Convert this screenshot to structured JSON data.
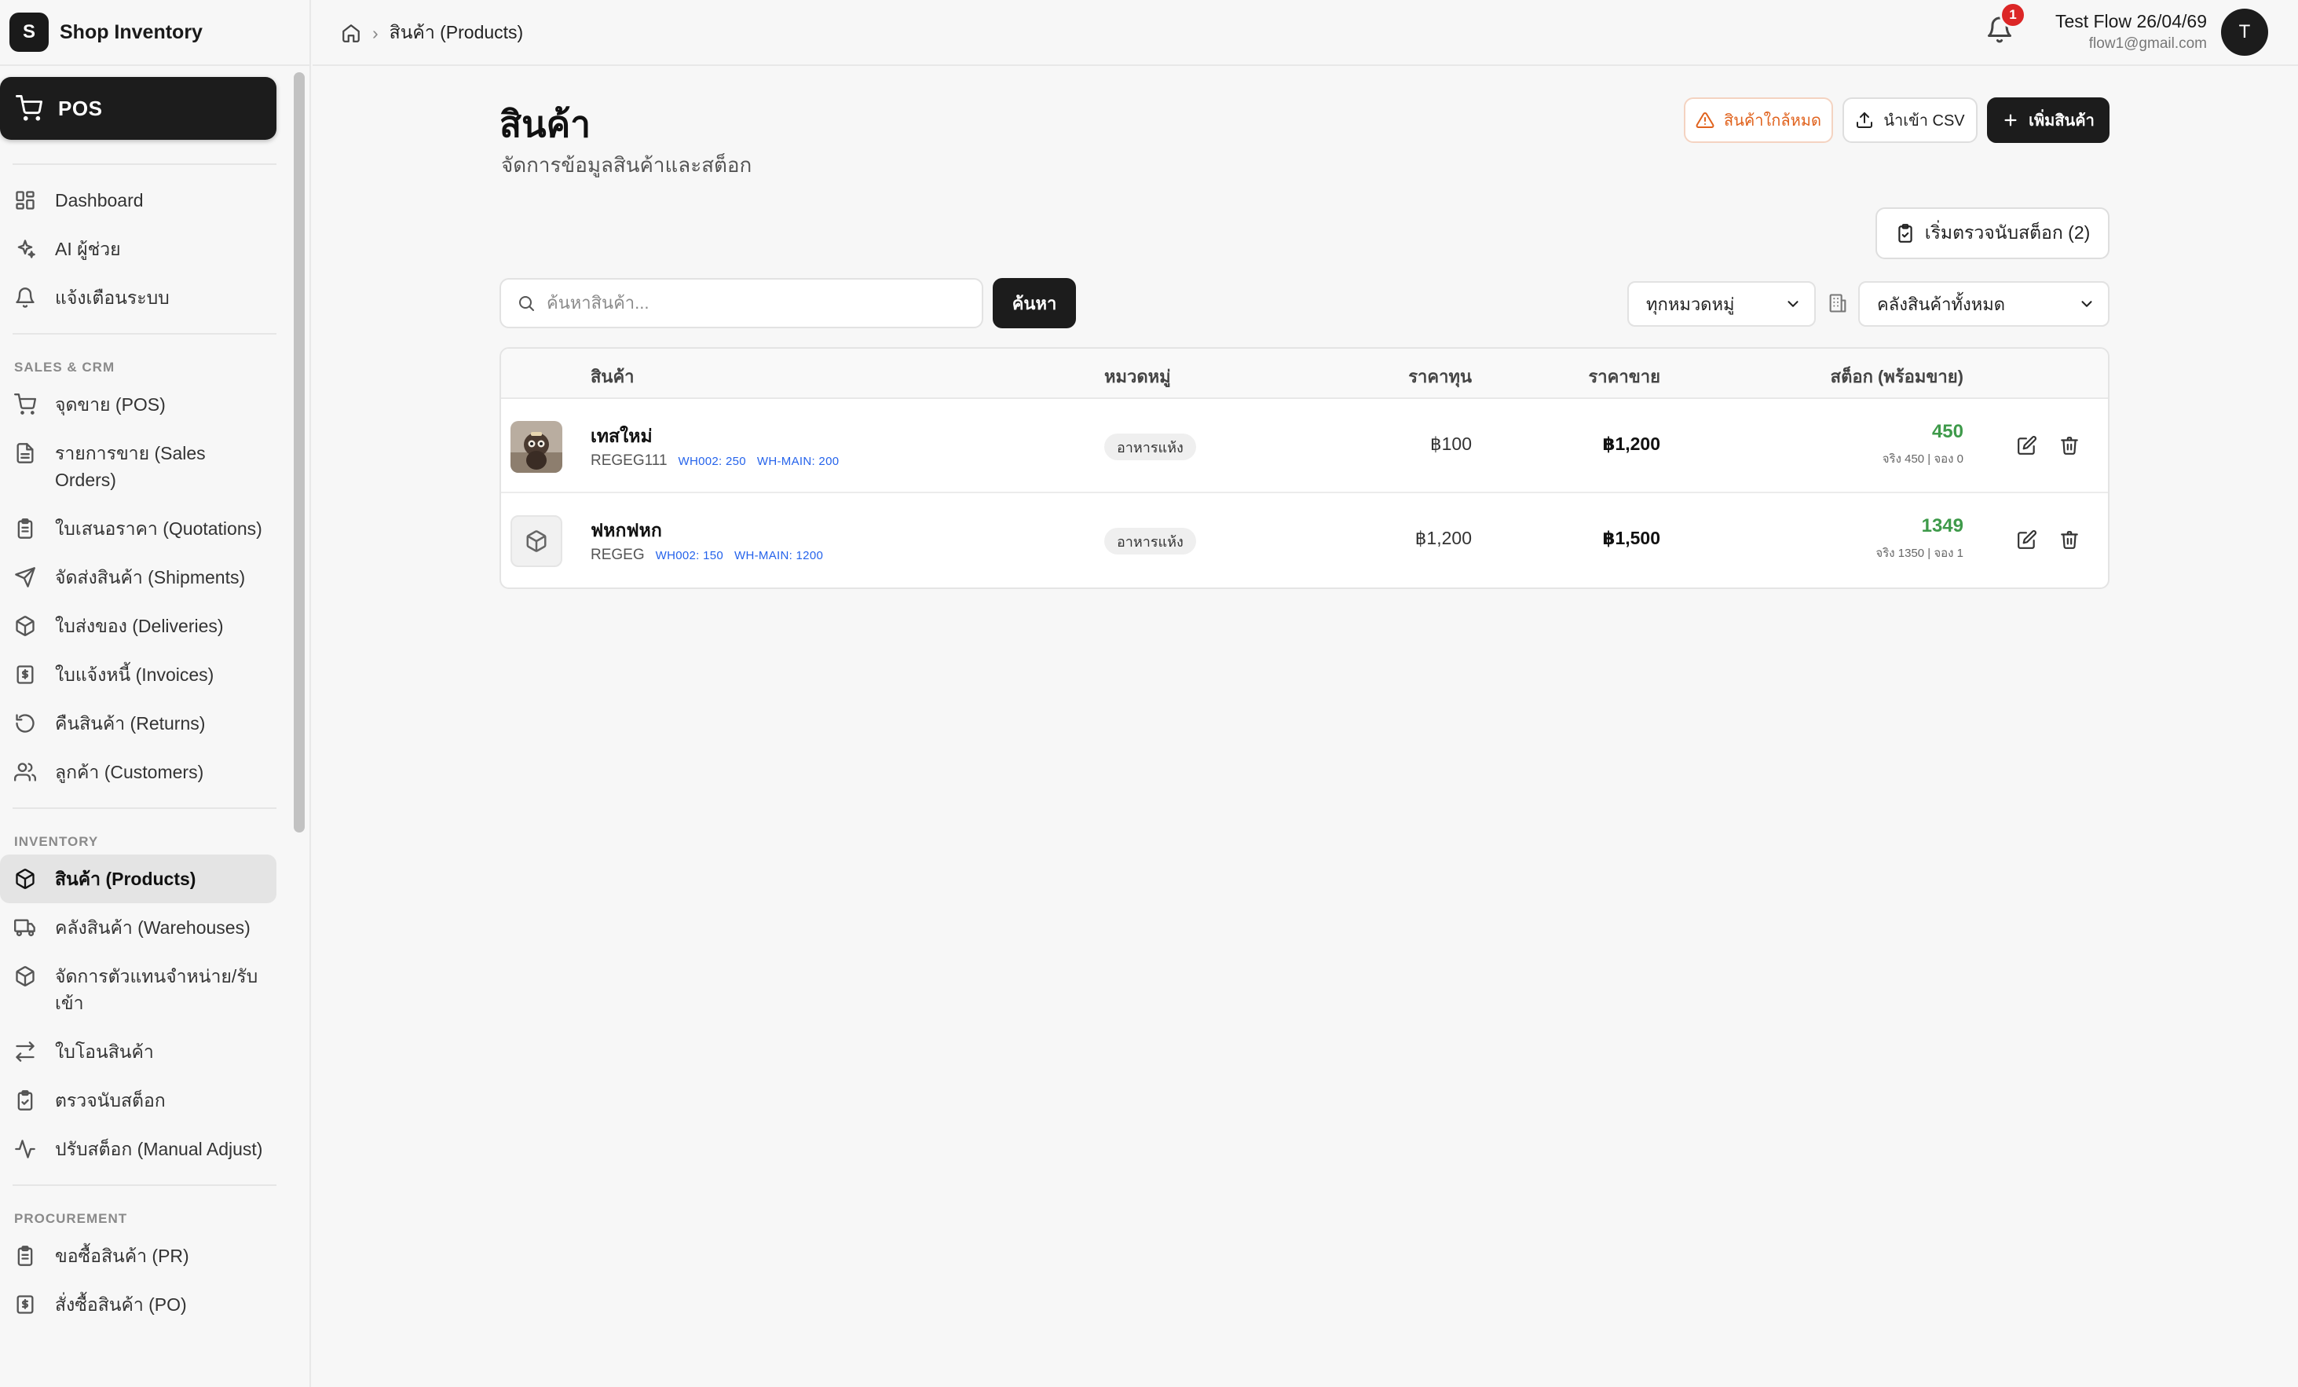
{
  "app": {
    "logo_letter": "S",
    "name": "Shop Inventory"
  },
  "pos_button": "POS",
  "nav": {
    "top_items": [
      {
        "label": "Dashboard",
        "icon": "grid-icon"
      },
      {
        "label": "AI ผู้ช่วย",
        "icon": "sparkle-icon"
      },
      {
        "label": "แจ้งเตือนระบบ",
        "icon": "bell-icon"
      }
    ],
    "sections": [
      {
        "title": "SALES & CRM",
        "items": [
          {
            "label": "จุดขาย (POS)",
            "icon": "cart-icon"
          },
          {
            "label": "รายการขาย (Sales Orders)",
            "icon": "document-icon"
          },
          {
            "label": "ใบเสนอราคา (Quotations)",
            "icon": "clipboard-list-icon"
          },
          {
            "label": "จัดส่งสินค้า (Shipments)",
            "icon": "send-icon"
          },
          {
            "label": "ใบส่งของ (Deliveries)",
            "icon": "package-icon"
          },
          {
            "label": "ใบแจ้งหนี้ (Invoices)",
            "icon": "invoice-icon"
          },
          {
            "label": "คืนสินค้า (Returns)",
            "icon": "rotate-icon"
          },
          {
            "label": "ลูกค้า (Customers)",
            "icon": "users-icon"
          }
        ]
      },
      {
        "title": "INVENTORY",
        "items": [
          {
            "label": "สินค้า (Products)",
            "icon": "package-icon",
            "active": true
          },
          {
            "label": "คลังสินค้า (Warehouses)",
            "icon": "truck-icon"
          },
          {
            "label": "จัดการตัวแทนจำหน่าย/รับเข้า",
            "icon": "package-icon"
          },
          {
            "label": "ใบโอนสินค้า",
            "icon": "transfer-icon"
          },
          {
            "label": "ตรวจนับสต็อก",
            "icon": "clipboard-check-icon"
          },
          {
            "label": "ปรับสต็อก (Manual Adjust)",
            "icon": "activity-icon"
          }
        ]
      },
      {
        "title": "PROCUREMENT",
        "items": [
          {
            "label": "ขอซื้อสินค้า (PR)",
            "icon": "clipboard-list-icon"
          },
          {
            "label": "สั่งซื้อสินค้า (PO)",
            "icon": "invoice-icon"
          }
        ]
      }
    ]
  },
  "breadcrumb": {
    "current": "สินค้า (Products)"
  },
  "user": {
    "name": "Test Flow 26/04/69",
    "email": "flow1@gmail.com",
    "initial": "T",
    "notifications": "1"
  },
  "page": {
    "title": "สินค้า",
    "subtitle": "จัดการข้อมูลสินค้าและสต็อก",
    "low_stock_button": "สินค้าใกล้หมด",
    "import_button": "นำเข้า CSV",
    "add_button": "เพิ่มสินค้า",
    "stock_count_button": "เริ่มตรวจนับสต็อก (2)",
    "search_placeholder": "ค้นหาสินค้า...",
    "search_button": "ค้นหา",
    "category_filter": "ทุกหมวดหมู่",
    "warehouse_filter": "คลังสินค้าทั้งหมด"
  },
  "table": {
    "headers": {
      "product": "สินค้า",
      "category": "หมวดหมู่",
      "cost": "ราคาทุน",
      "price": "ราคาขาย",
      "stock": "สต็อก (พร้อมขาย)"
    },
    "rows": [
      {
        "name": "เทสใหม่",
        "sku": "REGEG111",
        "wh1": "WH002: 250",
        "wh2": "WH-MAIN: 200",
        "category": "อาหารแห้ง",
        "cost": "฿100",
        "price": "฿1,200",
        "stock": "450",
        "stock_detail": "จริง 450 | จอง 0",
        "thumb": "photo"
      },
      {
        "name": "ฟหกฟหก",
        "sku": "REGEG",
        "wh1": "WH002: 150",
        "wh2": "WH-MAIN: 1200",
        "category": "อาหารแห้ง",
        "cost": "฿1,200",
        "price": "฿1,500",
        "stock": "1349",
        "stock_detail": "จริง 1350 | จอง 1",
        "thumb": "package-icon"
      }
    ]
  },
  "colors": {
    "accent_dark": "#1c1c1c",
    "stock_green": "#3e9a4a",
    "warning_orange": "#e0621d",
    "warehouse_blue": "#2563eb",
    "badge_red": "#dc2626"
  }
}
